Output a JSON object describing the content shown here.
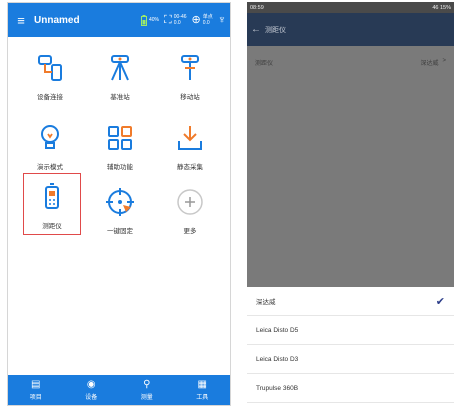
{
  "left": {
    "title": "Unnamed",
    "menu_icon": "≡",
    "status": {
      "battery": "40%",
      "g1_top": "00-46",
      "g1_bottom": "0.0",
      "g2_top": "单点",
      "g2_bottom": "0.0"
    },
    "tiles": [
      {
        "label": "设备连接",
        "icon": "device-connect-icon"
      },
      {
        "label": "基准站",
        "icon": "base-station-icon"
      },
      {
        "label": "移动站",
        "icon": "rover-icon"
      },
      {
        "label": "演示模式",
        "icon": "lightbulb-icon"
      },
      {
        "label": "辅助功能",
        "icon": "grid-icon"
      },
      {
        "label": "静态采集",
        "icon": "download-icon"
      },
      {
        "label": "测距仪",
        "icon": "rangefinder-icon"
      },
      {
        "label": "一键固定",
        "icon": "crosshair-icon"
      },
      {
        "label": "更多",
        "icon": "plus-icon"
      }
    ],
    "nav": [
      {
        "label": "项目",
        "icon": "doc-icon"
      },
      {
        "label": "设备",
        "icon": "device-icon"
      },
      {
        "label": "测量",
        "icon": "measure-icon"
      },
      {
        "label": "工具",
        "icon": "tool-icon"
      }
    ]
  },
  "right": {
    "status_left": "08:59",
    "status_right": "46 15%",
    "toolbar_title": "测距仪",
    "row_label": "测距仪",
    "row_value": "深达威",
    "row_arrow": ">",
    "options": [
      {
        "label": "深达威",
        "selected": true
      },
      {
        "label": "Leica Disto D5",
        "selected": false
      },
      {
        "label": "Leica Disto D3",
        "selected": false
      },
      {
        "label": "Trupulse 360B",
        "selected": false
      }
    ],
    "check_mark": "✔"
  }
}
